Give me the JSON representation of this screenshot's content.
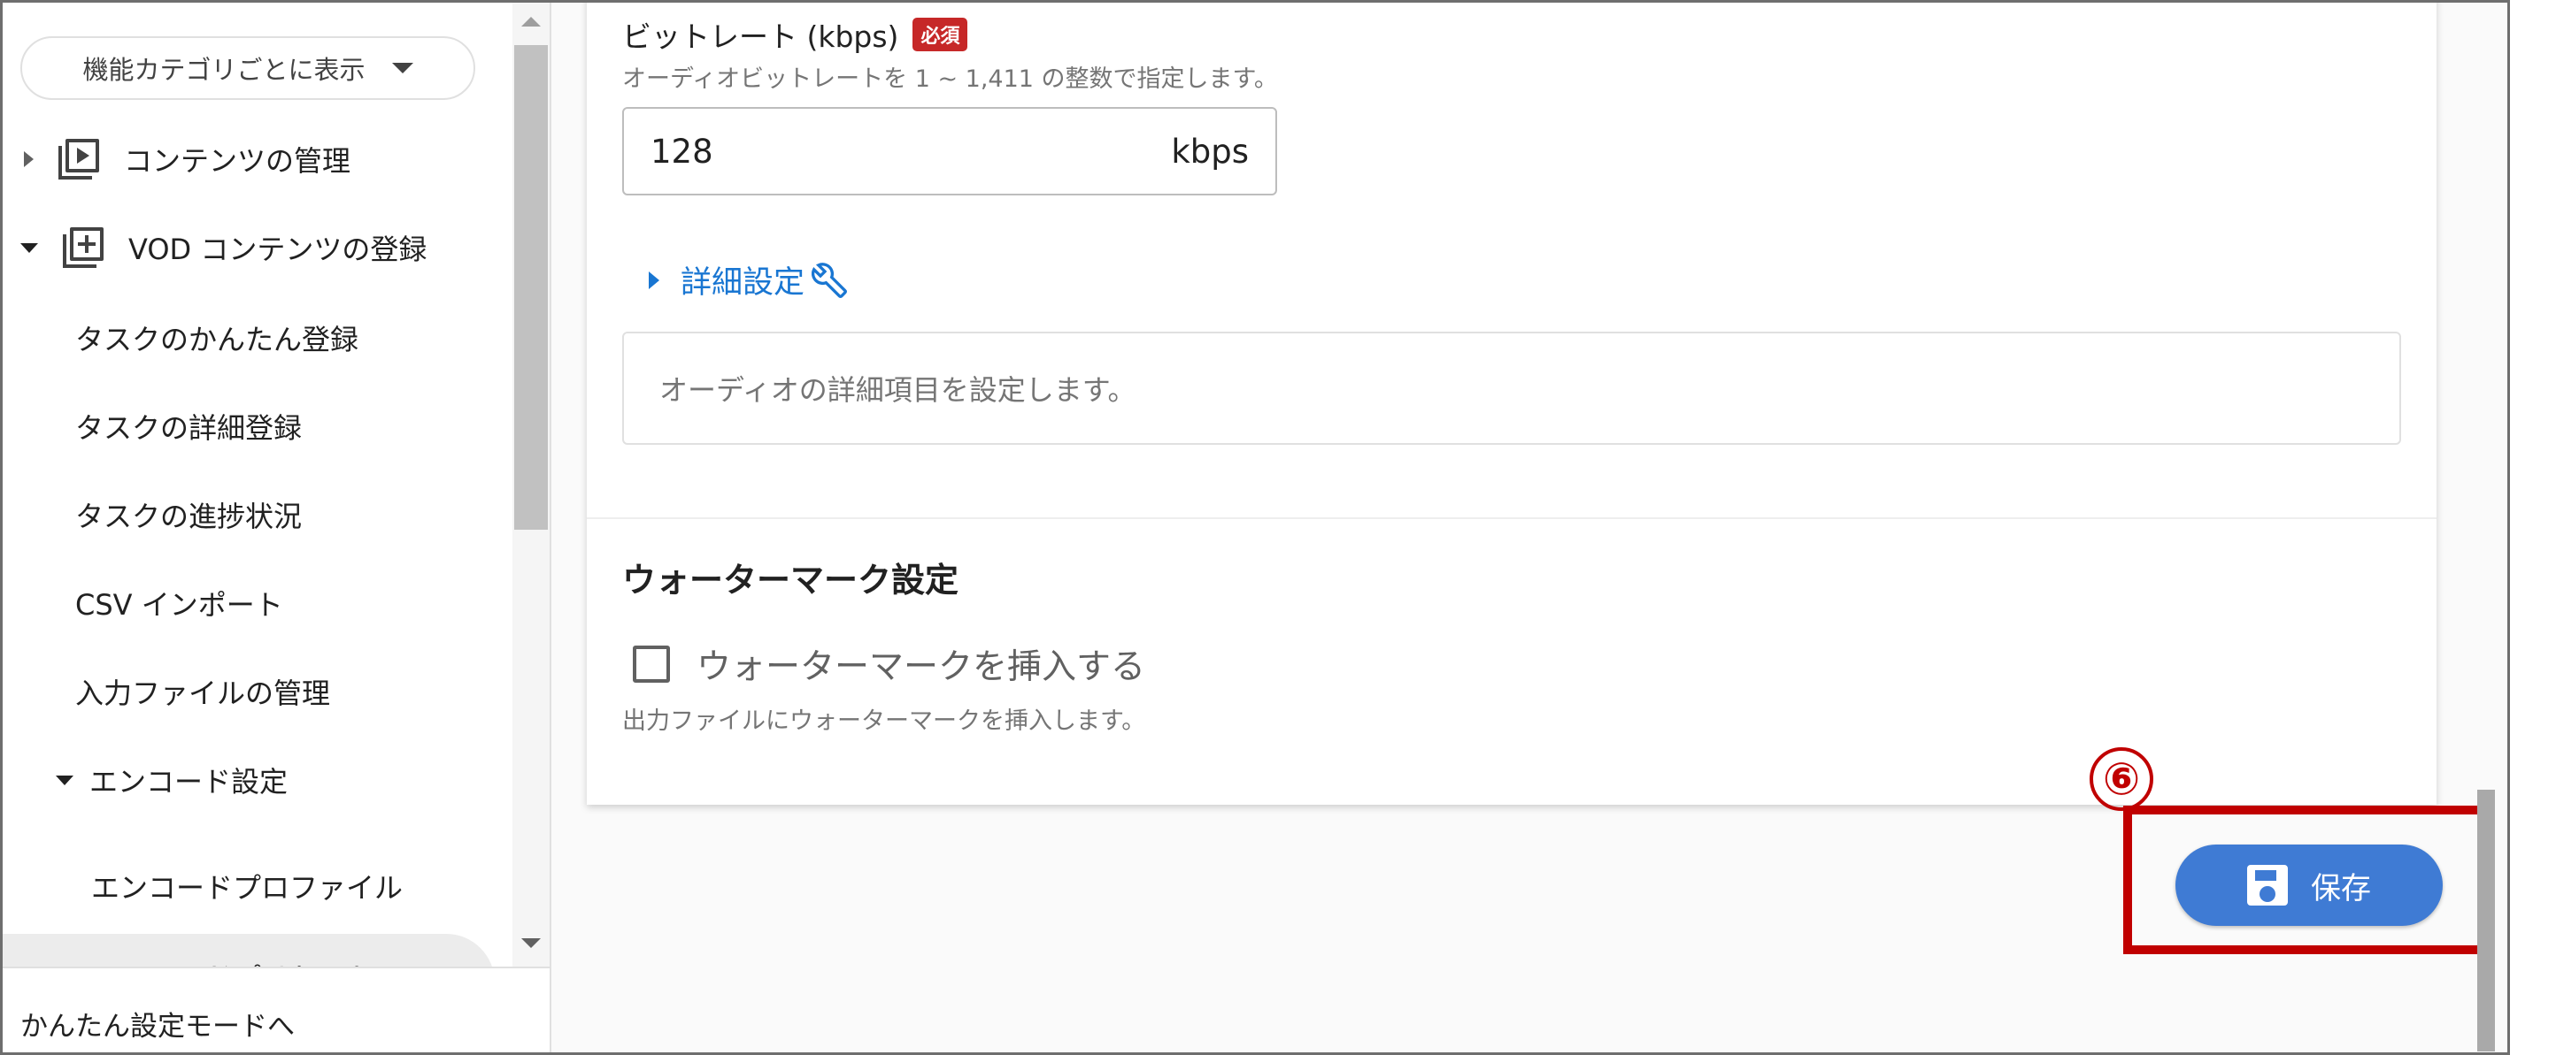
{
  "sidebar": {
    "category_select": "機能カテゴリごとに表示",
    "items": [
      {
        "label": "コンテンツの管理"
      },
      {
        "label": "VOD コンテンツの登録"
      },
      {
        "label": "タスクのかんたん登録"
      },
      {
        "label": "タスクの詳細登録"
      },
      {
        "label": "タスクの進捗状況"
      },
      {
        "label": "CSV インポート"
      },
      {
        "label": "入力ファイルの管理"
      },
      {
        "label": "エンコード設定"
      },
      {
        "label": "エンコードプロファイル"
      },
      {
        "label": "エンコードプリセット"
      }
    ],
    "footer_link": "かんたん設定モードへ"
  },
  "audio": {
    "bitrate_label": "ビットレート (kbps)",
    "required_badge": "必須",
    "bitrate_helper": "オーディオビットレートを 1 ~ 1,411 の整数で指定します。",
    "bitrate_value": "128",
    "bitrate_unit": "kbps",
    "advanced_label": "詳細設定",
    "advanced_placeholder": "オーディオの詳細項目を設定します。"
  },
  "watermark": {
    "title": "ウォーターマーク設定",
    "checkbox_label": "ウォーターマークを挿入する",
    "checked": false,
    "helper": "出力ファイルにウォーターマークを挿入します。"
  },
  "annotation": {
    "number": "⑥"
  },
  "save_button": {
    "label": "保存"
  },
  "colors": {
    "primary": "#3f7bd4",
    "link": "#1976d2",
    "required": "#c62828",
    "annotation": "#c00000"
  }
}
